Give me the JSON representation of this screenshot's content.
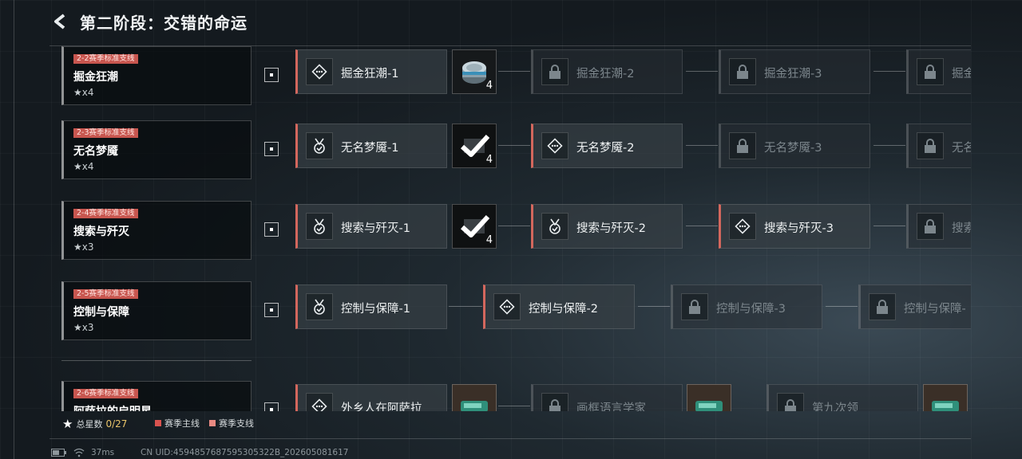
{
  "header": {
    "title": "第二阶段：交错的命运"
  },
  "rows": [
    {
      "tag": "2-2赛季标准支线",
      "name": "掘金狂潮",
      "stars": "x4",
      "nodes": [
        {
          "label": "掘金狂潮-1",
          "icon": "diamond-dots-icon",
          "locked": false
        },
        {
          "label": "掘金狂潮-2",
          "icon": "lock-icon",
          "locked": true
        },
        {
          "label": "掘金狂潮-3",
          "icon": "lock-icon",
          "locked": true
        },
        {
          "label": "掘金",
          "icon": "lock-icon",
          "locked": true
        }
      ],
      "reward": {
        "count": "4",
        "icon": "canned-food-icon",
        "claimed": false
      }
    },
    {
      "tag": "2-3赛季标准支线",
      "name": "无名梦魇",
      "stars": "x4",
      "nodes": [
        {
          "label": "无名梦魇-1",
          "icon": "medal-check-icon",
          "locked": false
        },
        {
          "label": "无名梦魇-2",
          "icon": "diamond-dots-icon",
          "locked": false
        },
        {
          "label": "无名梦魇-3",
          "icon": "lock-icon",
          "locked": true
        },
        {
          "label": "无名",
          "icon": "lock-icon",
          "locked": true
        }
      ],
      "reward": {
        "count": "4",
        "icon": "checkmark-icon",
        "claimed": true
      }
    },
    {
      "tag": "2-4赛季标准支线",
      "name": "搜索与歼灭",
      "stars": "x3",
      "nodes": [
        {
          "label": "搜索与歼灭-1",
          "icon": "medal-check-icon",
          "locked": false
        },
        {
          "label": "搜索与歼灭-2",
          "icon": "medal-check-icon",
          "locked": false
        },
        {
          "label": "搜索与歼灭-3",
          "icon": "diamond-dots-icon",
          "locked": false
        },
        {
          "label": "搜索",
          "icon": "lock-icon",
          "locked": true
        }
      ],
      "reward": {
        "count": "4",
        "icon": "checkmark-icon",
        "claimed": true
      }
    },
    {
      "tag": "2-5赛季标准支线",
      "name": "控制与保障",
      "stars": "x3",
      "nodes": [
        {
          "label": "控制与保障-1",
          "icon": "medal-check-icon",
          "locked": false
        },
        {
          "label": "控制与保障-2",
          "icon": "diamond-dots-icon",
          "locked": false
        },
        {
          "label": "控制与保障-3",
          "icon": "lock-icon",
          "locked": true
        },
        {
          "label": "控制与保障-",
          "icon": "lock-icon",
          "locked": true
        }
      ]
    },
    {
      "tag": "2-6赛季标准支线",
      "name": "阿萨拉的启明星",
      "stars": "",
      "nodes": [
        {
          "label": "外乡人在阿萨拉",
          "icon": "diamond-dots-icon",
          "locked": false
        },
        {
          "label": "画框语言学家",
          "icon": "lock-icon",
          "locked": true
        },
        {
          "label": "第九次领",
          "icon": "lock-icon",
          "locked": true
        }
      ],
      "reward": {
        "icon": "green-item-icon"
      }
    }
  ],
  "footer": {
    "total_label": "总星数",
    "total_value": "0/27",
    "legend": [
      {
        "label": "赛季主线",
        "color": "#d9534f"
      },
      {
        "label": "赛季支线",
        "color": "#e98a82"
      }
    ]
  },
  "status": {
    "ping": "37ms",
    "uid": "CN UID:4594857687595305322B_202605081617"
  },
  "colors": {
    "accent": "#d4675d",
    "value": "#e9c46a"
  }
}
